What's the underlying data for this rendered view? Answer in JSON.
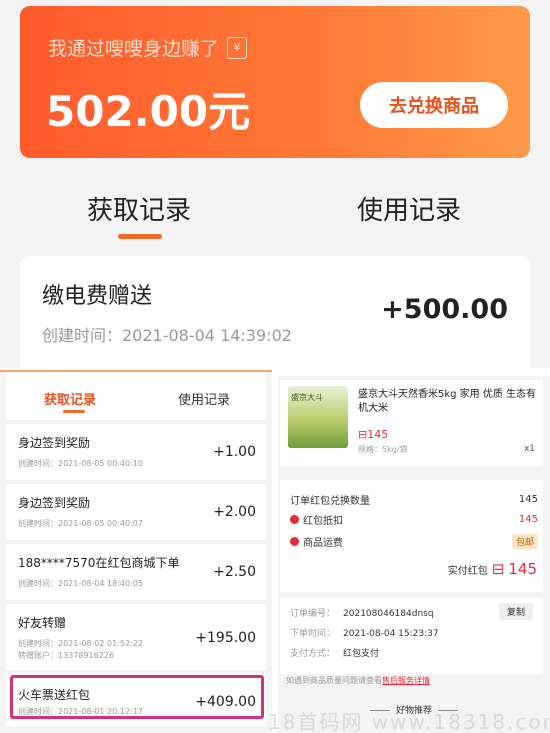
{
  "banner": {
    "subtitle": "我通过嗖嗖身边赚了",
    "amount": "502.00元",
    "redeem_label": "去兑换商品",
    "ticket_glyph": "¥"
  },
  "main_tabs": {
    "earn": "获取记录",
    "use": "使用记录"
  },
  "main_record": {
    "title": "缴电费赠送",
    "time": "创建时间：2021-08-04 14:39:02",
    "amount": "+500.00"
  },
  "small_tabs": {
    "earn": "获取记录",
    "use": "使用记录"
  },
  "records": [
    {
      "title": "身边签到奖励",
      "time": "创建时间：2021-08-05 00:40:10",
      "amount": "+1.00"
    },
    {
      "title": "身边签到奖励",
      "time": "创建时间：2021-08-05 00:40:07",
      "amount": "+2.00"
    },
    {
      "title": "188****7570在红包商城下单",
      "time": "创建时间：2021-08-04 18:40:05",
      "amount": "+2.50"
    },
    {
      "title": "好友转赠",
      "time": "创建时间：2021-08-02 01:52:22",
      "account": "转赠账户：13378916226",
      "amount": "+195.00"
    },
    {
      "title": "火车票送红包",
      "time": "创建时间：2021-08-01 20:12:17",
      "amount": "+409.00"
    }
  ],
  "product": {
    "name": "盛京大斗天然香米5kg 家用 优质 生态有机大米",
    "price": "145",
    "spec": "规格：5kg/袋",
    "qty": "x1",
    "img_label": "盛京大斗"
  },
  "summary": {
    "count_label": "订单红包兑换数量",
    "count_value": "145",
    "deduct_label": "红包抵扣",
    "deduct_value": "145",
    "shipping_label": "商品运费",
    "shipping_value": "包邮",
    "paid_label": "实付红包",
    "paid_value": "145"
  },
  "order": {
    "no_label": "订单编号：",
    "no_value": "202108046184dnsq",
    "copy_label": "复制",
    "time_label": "下单时间：",
    "time_value": "2021-08-04 15:23:37",
    "pay_label": "支付方式：",
    "pay_value": "红包支付"
  },
  "note": {
    "text": "如遇到商品质量问题请查看",
    "link": "售后服务详情"
  },
  "recommend": "好物推荐",
  "watermark": "18首码网 www.18318.com",
  "colors": {
    "accent": "#f06a2a",
    "price_red": "#e8283c",
    "highlight": "#d4317a"
  }
}
